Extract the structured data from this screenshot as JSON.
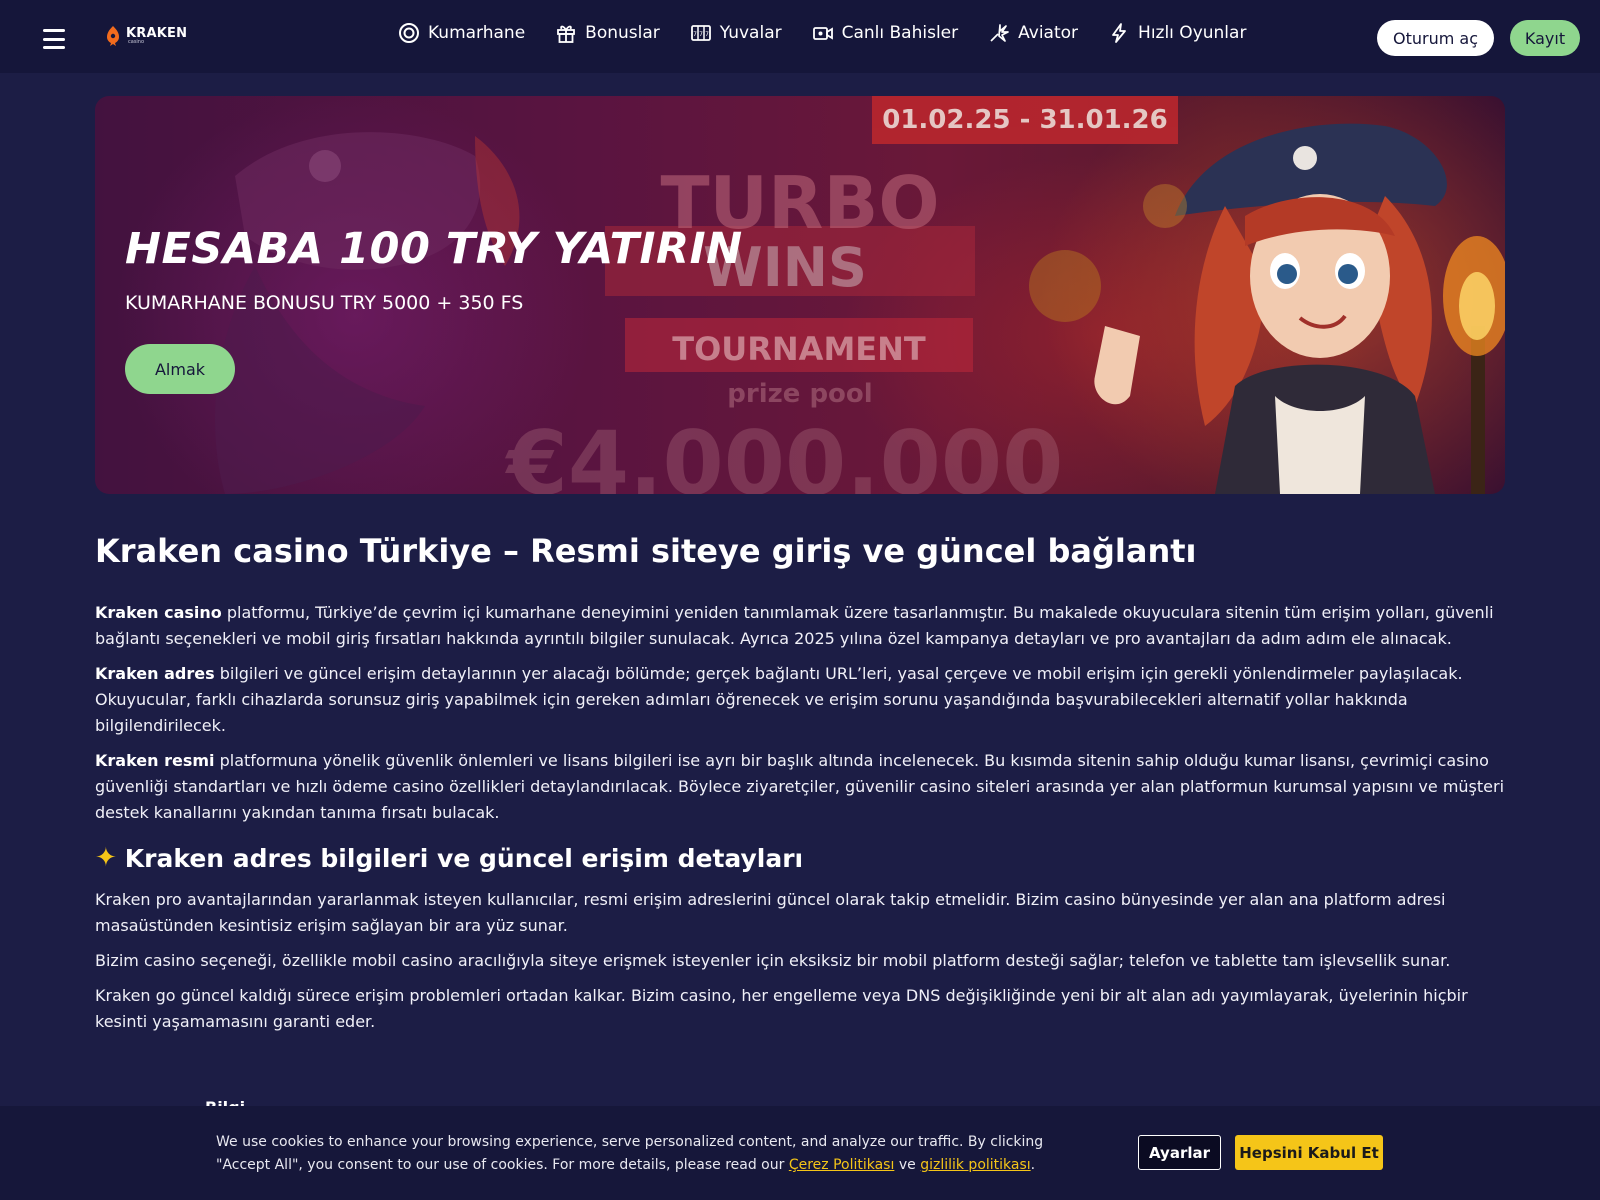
{
  "header": {
    "logo_name": "KRAKEN",
    "logo_sub": "casino",
    "nav": [
      {
        "label": "Kumarhane",
        "icon": "casino-chip-icon"
      },
      {
        "label": "Bonuslar",
        "icon": "gift-icon"
      },
      {
        "label": "Yuvalar",
        "icon": "slots-icon"
      },
      {
        "label": "Canlı Bahisler",
        "icon": "live-camera-icon"
      },
      {
        "label": "Aviator",
        "icon": "aviator-plane-icon"
      },
      {
        "label": "Hızlı Oyunlar",
        "icon": "lightning-icon"
      }
    ],
    "login_label": "Oturum aç",
    "register_label": "Kayıt"
  },
  "banner": {
    "dates": "01.02.25 - 31.01.26",
    "art_turbo": "TURBO",
    "art_wins": "WINS",
    "art_tournament": "TOURNAMENT",
    "art_prize": "prize pool",
    "art_amount": "€4.000.000",
    "title": "HESABA 100 TRY YATIRIN",
    "subtitle": "KUMARHANE BONUSU TRY 5000 + 350 FS",
    "cta_label": "Almak"
  },
  "article": {
    "h1": "Kraken casino Türkiye – Resmi siteye giriş ve güncel bağlantı",
    "intro": [
      {
        "bold": "Kraken casino",
        "text": " platformu, Türkiye’de çevrim içi kumarhane deneyimini yeniden tanımlamak üzere tasarlanmıştır. Bu makalede okuyuculara sitenin tüm erişim yolları, güvenli bağlantı seçenekleri ve mobil giriş fırsatları hakkında ayrıntılı bilgiler sunulacak. Ayrıca 2025 yılına özel kampanya detayları ve pro avantajları da adım adım ele alınacak."
      },
      {
        "bold": "Kraken adres",
        "text": " bilgileri ve güncel erişim detaylarının yer alacağı bölümde; gerçek bağlantı URL’leri, yasal çerçeve ve mobil erişim için gerekli yönlendirmeler paylaşılacak. Okuyucular, farklı cihazlarda sorunsuz giriş yapabilmek için gereken adımları öğrenecek ve erişim sorunu yaşandığında başvurabilecekleri alternatif yollar hakkında bilgilendirilecek."
      },
      {
        "bold": "Kraken resmi",
        "text": " platformuna yönelik güvenlik önlemleri ve lisans bilgileri ise ayrı bir başlık altında incelenecek. Bu kısımda sitenin sahip olduğu kumar lisansı, çevrimiçi casino güvenliği standartları ve hızlı ödeme casino özellikleri detaylandırılacak. Böylece ziyaretçiler, güvenilir casino siteleri arasında yer alan platformun kurumsal yapısını ve müşteri destek kanallarını yakından tanıma fırsatı bulacak."
      }
    ],
    "h2_icon": "✦",
    "h2": "Kraken adres bilgileri ve güncel erişim detayları",
    "section": [
      "Kraken pro avantajlarından yararlanmak isteyen kullanıcılar, resmi erişim adreslerini güncel olarak takip etmelidir. Bizim casino bünyesinde yer alan ana platform adresi masaüstünden kesintisiz erişim sağlayan bir ara yüz sunar.",
      "Bizim casino seçeneği, özellikle mobil casino aracılığıyla siteye erişmek isteyenler için eksiksiz bir mobil platform desteği sağlar; telefon ve tablette tam işlevsellik sunar.",
      "Kraken go güncel kaldığı sürece erişim problemleri ortadan kalkar. Bizim casino, her engelleme veya DNS değişikliğinde yeni bir alt alan adı yayımlayarak, üyelerinin hiçbir kesinti yaşamamasını garanti eder."
    ]
  },
  "cookie": {
    "peek_text": "Bilgi",
    "text_before": "We use cookies to enhance your browsing experience, serve personalized content, and analyze our traffic. By clicking \"Accept All\", you consent to our use of cookies. For more details, please read our ",
    "link1": "Çerez Politikası",
    "text_between": " ve ",
    "link2": "gizlilik politikası",
    "text_after": ".",
    "settings_label": "Ayarlar",
    "accept_label": "Hepsini Kabul Et"
  },
  "colors": {
    "background": "#1c1d45",
    "header": "#15163a",
    "accent_green": "#8fd68e",
    "accent_yellow": "#f5c518"
  }
}
